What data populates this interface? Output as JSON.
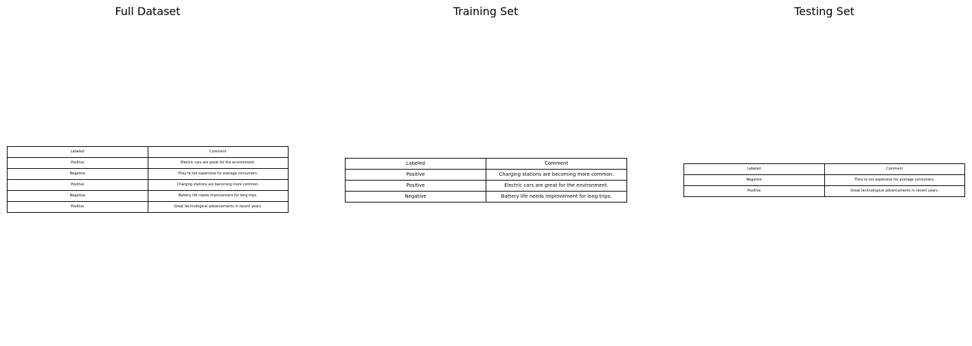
{
  "chart_data": [
    {
      "type": "table",
      "title": "Full Dataset",
      "columns": [
        "Labeled",
        "Comment"
      ],
      "rows": [
        [
          "Positive",
          "Electric cars are great for the environment."
        ],
        [
          "Negative",
          "They're too expensive for average consumers."
        ],
        [
          "Positive",
          "Charging stations are becoming more common."
        ],
        [
          "Negative",
          "Battery life needs improvement for long trips."
        ],
        [
          "Positive",
          "Great technological advancements in recent years."
        ]
      ]
    },
    {
      "type": "table",
      "title": "Training Set",
      "columns": [
        "Labeled",
        "Comment"
      ],
      "rows": [
        [
          "Positive",
          "Charging stations are becoming more common."
        ],
        [
          "Positive",
          "Electric cars are great for the environment."
        ],
        [
          "Negative",
          "Battery life needs improvement for long trips."
        ]
      ]
    },
    {
      "type": "table",
      "title": "Testing Set",
      "columns": [
        "Labeled",
        "Comment"
      ],
      "rows": [
        [
          "Negative",
          "They're too expensive for average consumers."
        ],
        [
          "Positive",
          "Great technological advancements in recent years."
        ]
      ]
    }
  ]
}
